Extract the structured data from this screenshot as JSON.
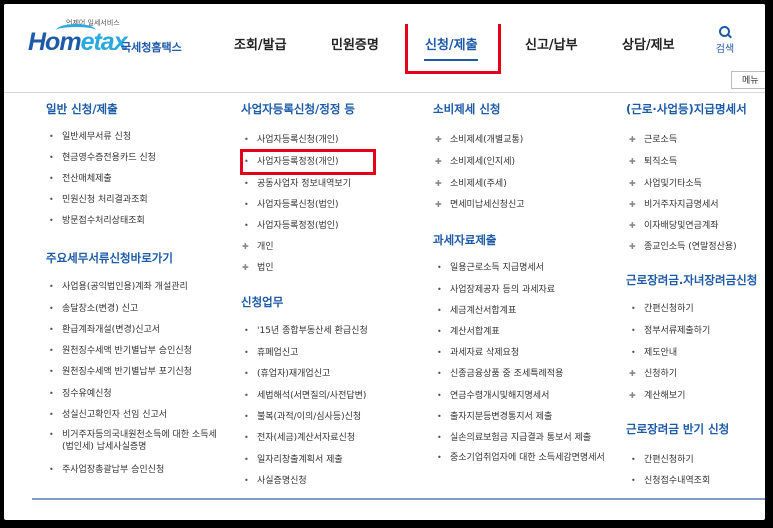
{
  "logo": {
    "tagline": "언제어 일세서비스",
    "word_a": "Hom",
    "word_b": "etax",
    "korean": "국세청홈택스"
  },
  "nav": [
    {
      "label": "조회/발급"
    },
    {
      "label": "민원증명"
    },
    {
      "label": "신청/제출"
    },
    {
      "label": "신고/납부"
    },
    {
      "label": "상담/제보"
    }
  ],
  "search": {
    "label": "검색",
    "icon": "search-icon"
  },
  "menu_button": {
    "label": "메뉴"
  },
  "columns": {
    "c1": {
      "s1": {
        "title": "일반 신청/제출",
        "items": [
          "일반세무서류 신청",
          "현금영수증전용카드 신청",
          "전산매체제출",
          "민원신청 처리결과조회",
          "방문접수처리상태조회"
        ]
      },
      "s2": {
        "title": "주요세무서류신청바로가기",
        "items": [
          "사업용(공익법인용)계좌 개설관리",
          "송달장소(변경) 신고",
          "환급계좌개설(변경)신고서",
          "원천징수세액 반기별납부 승인신청",
          "원천징수세액 반기별납부 포기신청",
          "징수유예신청",
          "성실신고확인자 선임 신고서",
          "비거주자등의국내원천소득에 대한 소득세(법인세) 납세사실증명",
          "주사업장총괄납부 승인신청"
        ]
      }
    },
    "c2": {
      "s1": {
        "title": "사업자등록신청/정정 등",
        "items": [
          "사업자등록신청(개인)",
          "사업자등록정정(개인)",
          "공동사업자 정보내역보기",
          "사업자등록신청(법인)",
          "사업자등록정정(법인)",
          "개인",
          "법인"
        ]
      },
      "s2": {
        "title": "신청업무",
        "items": [
          "'15년 종합부동산세 환급신청",
          "휴폐업신고",
          "(휴업자)재개업신고",
          "세법해석(서면질의/사전답변)",
          "불복(과적/이의/심사등)신청",
          "전자(세금)계산서자료신청",
          "일자리창출계획서 제출",
          "사실증명신청"
        ]
      }
    },
    "c3": {
      "s1": {
        "title": "소비제세 신청",
        "items": [
          "소비제세(개별교통)",
          "소비제세(인지세)",
          "소비제세(주세)",
          "면세미납세신청신고"
        ]
      },
      "s2": {
        "title": "과세자료제출",
        "items": [
          "일용근로소득 지급명세서",
          "사업장제공자 등의 과세자료",
          "세금계산서합계표",
          "계산서합계표",
          "과세자료 삭제요청",
          "신종금융상품 중 조세특례적용",
          "연금수령개시및해지명세서",
          "출자지분등변경통지서 제출",
          "실손의료보험금 지급결과 통보서 제출",
          "중소기업취업자에 대한 소득세감면명세서"
        ]
      }
    },
    "c4": {
      "s1": {
        "title": "(근로·사업등)지급명세서",
        "items": [
          "근로소득",
          "퇴직소득",
          "사업및기타소득",
          "비거주자지급명세서",
          "이자배당및연금계좌",
          "종교인소득 (연말정산용)"
        ]
      },
      "s2": {
        "title": "근로장려금.자녀장려금신청",
        "items": [
          "간편신청하기",
          "정부서류제출하기",
          "제도안내",
          "신청하기",
          "계산해보기"
        ]
      },
      "s3": {
        "title": "근로장려금 반기 신청",
        "items": [
          "간편신청하기",
          "신청접수내역조회"
        ]
      }
    }
  }
}
